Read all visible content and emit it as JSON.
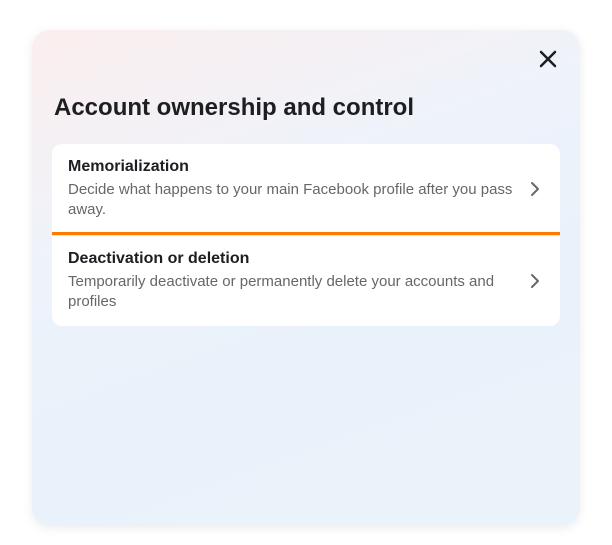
{
  "modal": {
    "title": "Account ownership and control",
    "close_label": "Close"
  },
  "items": [
    {
      "title": "Memorialization",
      "description": "Decide what happens to your main Facebook profile after you pass away."
    },
    {
      "title": "Deactivation or deletion",
      "description": "Temporarily deactivate or permanently delete your accounts and profiles"
    }
  ]
}
